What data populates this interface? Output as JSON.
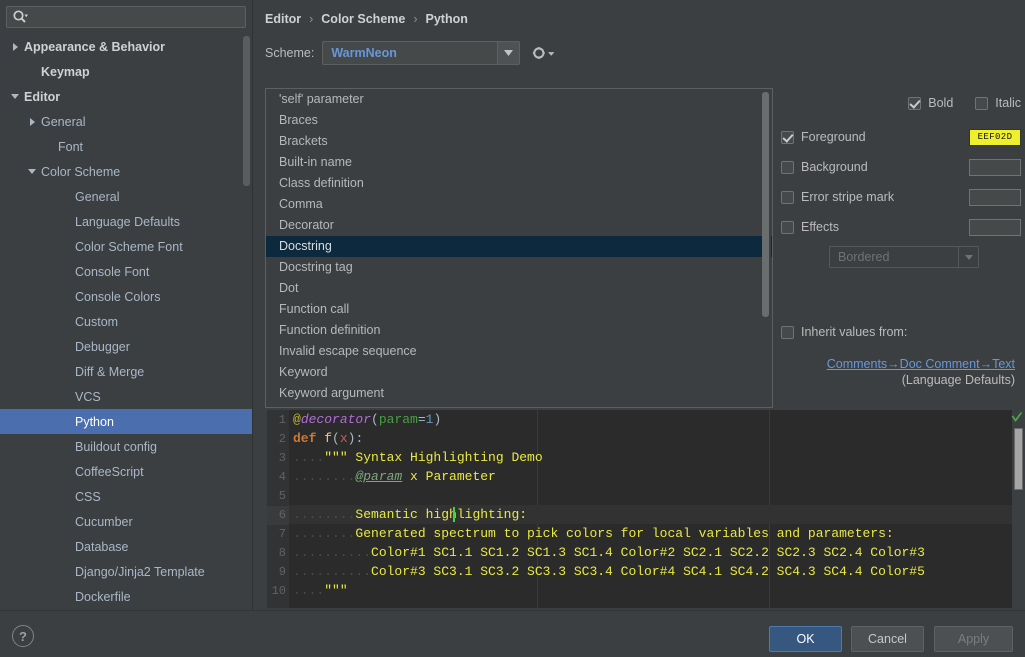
{
  "search": {
    "placeholder": "",
    "value": "",
    "icon": "search-icon"
  },
  "sidebar": {
    "items": [
      {
        "label": "Appearance & Behavior",
        "indent": 0,
        "arrow": "right",
        "bold": true,
        "selected": false
      },
      {
        "label": "Keymap",
        "indent": 1,
        "arrow": "none",
        "bold": true,
        "selected": false
      },
      {
        "label": "Editor",
        "indent": 0,
        "arrow": "down",
        "bold": true,
        "selected": false
      },
      {
        "label": "General",
        "indent": 1,
        "arrow": "right",
        "bold": false,
        "selected": false
      },
      {
        "label": "Font",
        "indent": 2,
        "arrow": "none",
        "bold": false,
        "selected": false
      },
      {
        "label": "Color Scheme",
        "indent": 1,
        "arrow": "down",
        "bold": false,
        "selected": false
      },
      {
        "label": "General",
        "indent": 3,
        "arrow": "none",
        "bold": false,
        "selected": false
      },
      {
        "label": "Language Defaults",
        "indent": 3,
        "arrow": "none",
        "bold": false,
        "selected": false
      },
      {
        "label": "Color Scheme Font",
        "indent": 3,
        "arrow": "none",
        "bold": false,
        "selected": false
      },
      {
        "label": "Console Font",
        "indent": 3,
        "arrow": "none",
        "bold": false,
        "selected": false
      },
      {
        "label": "Console Colors",
        "indent": 3,
        "arrow": "none",
        "bold": false,
        "selected": false
      },
      {
        "label": "Custom",
        "indent": 3,
        "arrow": "none",
        "bold": false,
        "selected": false
      },
      {
        "label": "Debugger",
        "indent": 3,
        "arrow": "none",
        "bold": false,
        "selected": false
      },
      {
        "label": "Diff & Merge",
        "indent": 3,
        "arrow": "none",
        "bold": false,
        "selected": false
      },
      {
        "label": "VCS",
        "indent": 3,
        "arrow": "none",
        "bold": false,
        "selected": false
      },
      {
        "label": "Python",
        "indent": 3,
        "arrow": "none",
        "bold": false,
        "selected": true
      },
      {
        "label": "Buildout config",
        "indent": 3,
        "arrow": "none",
        "bold": false,
        "selected": false
      },
      {
        "label": "CoffeeScript",
        "indent": 3,
        "arrow": "none",
        "bold": false,
        "selected": false
      },
      {
        "label": "CSS",
        "indent": 3,
        "arrow": "none",
        "bold": false,
        "selected": false
      },
      {
        "label": "Cucumber",
        "indent": 3,
        "arrow": "none",
        "bold": false,
        "selected": false
      },
      {
        "label": "Database",
        "indent": 3,
        "arrow": "none",
        "bold": false,
        "selected": false
      },
      {
        "label": "Django/Jinja2 Template",
        "indent": 3,
        "arrow": "none",
        "bold": false,
        "selected": false
      },
      {
        "label": "Dockerfile",
        "indent": 3,
        "arrow": "none",
        "bold": false,
        "selected": false
      }
    ]
  },
  "breadcrumb": {
    "parts": [
      "Editor",
      "Color Scheme",
      "Python"
    ],
    "separator": "›"
  },
  "scheme": {
    "label": "Scheme:",
    "value": "WarmNeon",
    "accent": "#6897d8",
    "gear_icon": "gear-icon",
    "arrow_icon": "chevron-down-icon"
  },
  "attributes": {
    "items": [
      {
        "label": "'self' parameter",
        "selected": false
      },
      {
        "label": "Braces",
        "selected": false
      },
      {
        "label": "Brackets",
        "selected": false
      },
      {
        "label": "Built-in name",
        "selected": false
      },
      {
        "label": "Class definition",
        "selected": false
      },
      {
        "label": "Comma",
        "selected": false
      },
      {
        "label": "Decorator",
        "selected": false
      },
      {
        "label": "Docstring",
        "selected": true
      },
      {
        "label": "Docstring tag",
        "selected": false
      },
      {
        "label": "Dot",
        "selected": false
      },
      {
        "label": "Function call",
        "selected": false
      },
      {
        "label": "Function definition",
        "selected": false
      },
      {
        "label": "Invalid escape sequence",
        "selected": false
      },
      {
        "label": "Keyword",
        "selected": false
      },
      {
        "label": "Keyword argument",
        "selected": false
      }
    ]
  },
  "options": {
    "bold": {
      "label": "Bold",
      "checked": true
    },
    "italic": {
      "label": "Italic",
      "checked": false
    },
    "rows": [
      {
        "label": "Foreground",
        "checked": true,
        "color": "#eef02d",
        "color_text": "EEF02D"
      },
      {
        "label": "Background",
        "checked": false,
        "color": "",
        "color_text": ""
      },
      {
        "label": "Error stripe mark",
        "checked": false,
        "color": "",
        "color_text": ""
      },
      {
        "label": "Effects",
        "checked": false,
        "color": "",
        "color_text": ""
      }
    ],
    "effect_select": {
      "value": "Bordered",
      "disabled": true,
      "arrow_icon": "chevron-down-icon"
    },
    "inherit": {
      "label": "Inherit values from:",
      "checked": false
    },
    "inherit_link": "Comments→Doc Comment→Text",
    "inherit_sub": "(Language Defaults)"
  },
  "preview": {
    "lines": [
      {
        "num": "1",
        "highlight": false,
        "tokens": [
          {
            "t": "@",
            "c": "tok-at"
          },
          {
            "t": "decorator",
            "c": "tok-dec"
          },
          {
            "t": "(",
            "c": "tok-paren"
          },
          {
            "t": "param",
            "c": "tok-kwarg"
          },
          {
            "t": "=",
            "c": "tok-paren"
          },
          {
            "t": "1",
            "c": "tok-num"
          },
          {
            "t": ")",
            "c": "tok-paren"
          }
        ]
      },
      {
        "num": "2",
        "highlight": false,
        "tokens": [
          {
            "t": "def",
            "c": "tok-kw"
          },
          {
            "t": " ",
            "c": "tok-paren"
          },
          {
            "t": "f",
            "c": "tok-fn"
          },
          {
            "t": "(",
            "c": "tok-paren"
          },
          {
            "t": "x",
            "c": "tok-param"
          },
          {
            "t": "):",
            "c": "tok-paren"
          }
        ]
      },
      {
        "num": "3",
        "highlight": false,
        "tokens": [
          {
            "t": "....",
            "c": "tok-dots"
          },
          {
            "t": "\"\"\" Syntax Highlighting Demo",
            "c": "tok-doc"
          }
        ]
      },
      {
        "num": "4",
        "highlight": false,
        "tokens": [
          {
            "t": "........",
            "c": "tok-dots"
          },
          {
            "t": "@param",
            "c": "tok-doctag"
          },
          {
            "t": " x Parameter",
            "c": "tok-doc"
          }
        ]
      },
      {
        "num": "5",
        "highlight": false,
        "tokens": []
      },
      {
        "num": "6",
        "highlight": true,
        "tokens": [
          {
            "t": "........",
            "c": "tok-dots"
          },
          {
            "t": "Semantic highlighting:",
            "c": "tok-doc"
          }
        ]
      },
      {
        "num": "7",
        "highlight": false,
        "tokens": [
          {
            "t": "........",
            "c": "tok-dots"
          },
          {
            "t": "Generated spectrum to pick colors for local variables and parameters:",
            "c": "tok-doc"
          }
        ]
      },
      {
        "num": "8",
        "highlight": false,
        "tokens": [
          {
            "t": "..........",
            "c": "tok-dots"
          },
          {
            "t": "Color#1 SC1.1 SC1.2 SC1.3 SC1.4 Color#2 SC2.1 SC2.2 SC2.3 SC2.4 Color#3",
            "c": "tok-doc"
          }
        ]
      },
      {
        "num": "9",
        "highlight": false,
        "tokens": [
          {
            "t": "..........",
            "c": "tok-dots"
          },
          {
            "t": "Color#3 SC3.1 SC3.2 SC3.3 SC3.4 Color#4 SC4.1 SC4.2 SC4.3 SC4.4 Color#5",
            "c": "tok-doc"
          }
        ]
      },
      {
        "num": "10",
        "highlight": false,
        "tokens": [
          {
            "t": "....",
            "c": "tok-dots"
          },
          {
            "t": "\"\"\"",
            "c": "tok-doc"
          }
        ]
      }
    ],
    "status_icon": "checkmark-icon"
  },
  "bottom": {
    "help": "?",
    "ok": "OK",
    "cancel": "Cancel",
    "apply": "Apply"
  }
}
